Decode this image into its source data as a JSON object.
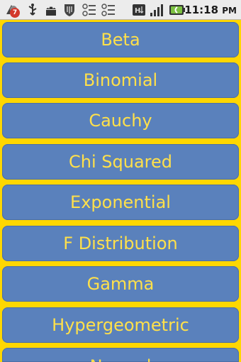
{
  "status_bar": {
    "notification_count": "7",
    "time": "11:18",
    "ampm": "PM"
  },
  "distributions": [
    {
      "label": "Beta"
    },
    {
      "label": "Binomial"
    },
    {
      "label": "Cauchy"
    },
    {
      "label": "Chi Squared"
    },
    {
      "label": "Exponential"
    },
    {
      "label": "F Distribution"
    },
    {
      "label": "Gamma"
    },
    {
      "label": "Hypergeometric"
    },
    {
      "label": "Normal"
    }
  ],
  "colors": {
    "background": "#FFD700",
    "item_fill": "#5A81BC",
    "item_text": "#FFE04A"
  }
}
